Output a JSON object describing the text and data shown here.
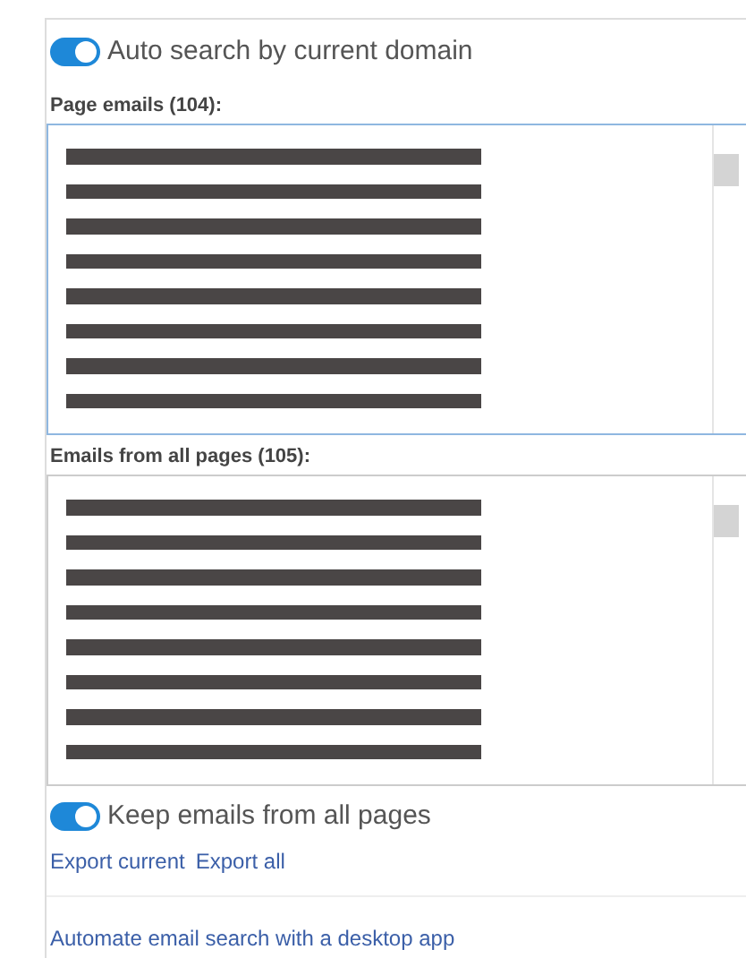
{
  "auto_search": {
    "label": "Auto search by current domain",
    "on": true
  },
  "page_emails": {
    "title": "Page emails (104):",
    "rows": [
      {
        "kind": "redacted"
      },
      {
        "kind": "redacted"
      },
      {
        "kind": "redacted"
      },
      {
        "kind": "redacted"
      },
      {
        "kind": "redacted"
      },
      {
        "kind": "redacted"
      },
      {
        "kind": "redacted"
      },
      {
        "kind": "redacted"
      }
    ]
  },
  "all_emails": {
    "title": "Emails from all pages (105):",
    "rows": [
      {
        "kind": "redacted"
      },
      {
        "kind": "redacted"
      },
      {
        "kind": "redacted"
      },
      {
        "kind": "redacted"
      },
      {
        "kind": "redacted"
      },
      {
        "kind": "redacted"
      },
      {
        "kind": "redacted"
      },
      {
        "kind": "redacted"
      }
    ]
  },
  "keep_emails": {
    "label": "Keep emails from all pages",
    "on": true
  },
  "export_links": [
    "Export current",
    "Export all"
  ],
  "footer_link": "Automate email search with a desktop app"
}
